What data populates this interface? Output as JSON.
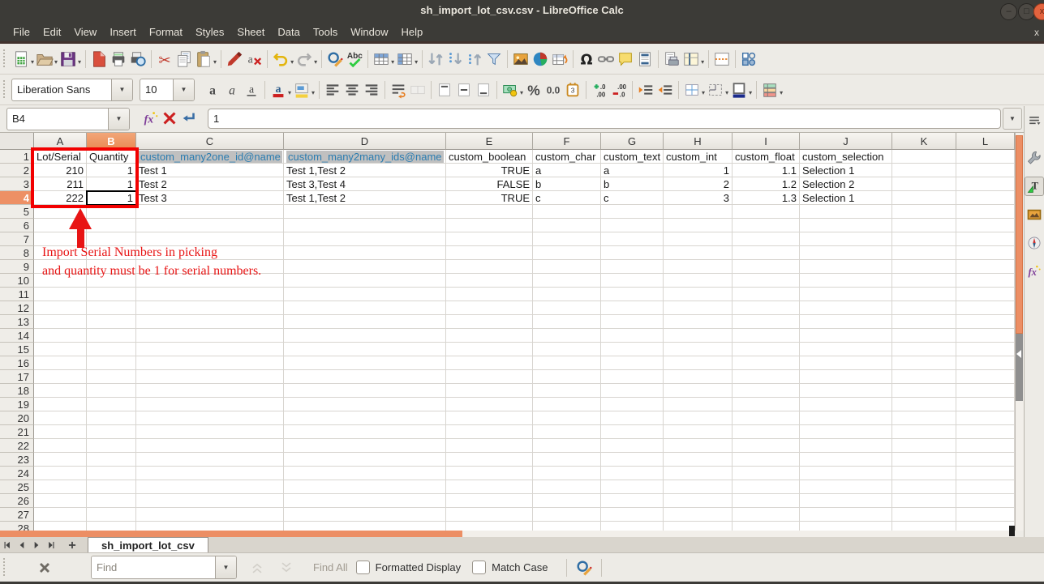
{
  "window": {
    "title": "sh_import_lot_csv.csv - LibreOffice Calc",
    "controls": [
      "minimize",
      "maximize",
      "close"
    ]
  },
  "menubar": {
    "items": [
      "File",
      "Edit",
      "View",
      "Insert",
      "Format",
      "Styles",
      "Sheet",
      "Data",
      "Tools",
      "Window",
      "Help"
    ]
  },
  "standard_toolbar": {
    "groups": [
      [
        {
          "name": "new-document",
          "dropdown": true
        },
        {
          "name": "open-folder",
          "dropdown": true
        },
        {
          "name": "save",
          "dropdown": true
        }
      ],
      [
        {
          "name": "export-pdf"
        },
        {
          "name": "print"
        },
        {
          "name": "print-preview"
        }
      ],
      [
        {
          "name": "cut"
        },
        {
          "name": "copy"
        },
        {
          "name": "paste",
          "dropdown": true
        }
      ],
      [
        {
          "name": "clone-formatting"
        },
        {
          "name": "clear-formatting"
        }
      ],
      [
        {
          "name": "undo",
          "dropdown": true
        },
        {
          "name": "redo",
          "dropdown": true
        }
      ],
      [
        {
          "name": "find-replace"
        },
        {
          "name": "spelling"
        }
      ],
      [
        {
          "name": "insert-row",
          "dropdown": true
        },
        {
          "name": "insert-column",
          "dropdown": true
        }
      ],
      [
        {
          "name": "sort"
        },
        {
          "name": "sort-descending"
        },
        {
          "name": "sort-ascending"
        },
        {
          "name": "autofilter"
        }
      ],
      [
        {
          "name": "insert-image"
        },
        {
          "name": "insert-chart"
        },
        {
          "name": "insert-pivot-table"
        }
      ],
      [
        {
          "name": "special-character"
        },
        {
          "name": "hyperlink"
        },
        {
          "name": "insert-comment"
        },
        {
          "name": "headers-footers"
        }
      ],
      [
        {
          "name": "print-area"
        },
        {
          "name": "freeze-panes",
          "dropdown": true
        }
      ],
      [
        {
          "name": "split-window"
        }
      ],
      [
        {
          "name": "show-draw-functions"
        }
      ]
    ]
  },
  "formatting_toolbar": {
    "font_name": "Liberation Sans",
    "font_size": "10",
    "groups": [
      [
        {
          "name": "bold"
        },
        {
          "name": "italic"
        },
        {
          "name": "underline"
        }
      ],
      [
        {
          "name": "font-color",
          "dropdown": true
        },
        {
          "name": "highlighting-color",
          "dropdown": true
        }
      ],
      [
        {
          "name": "align-left"
        },
        {
          "name": "align-center"
        },
        {
          "name": "align-right"
        }
      ],
      [
        {
          "name": "wrap-text"
        },
        {
          "name": "merge-cells",
          "disabled": true
        }
      ],
      [
        {
          "name": "align-top"
        },
        {
          "name": "center-vertically"
        },
        {
          "name": "align-bottom"
        }
      ],
      [
        {
          "name": "currency",
          "dropdown": true
        },
        {
          "name": "percent"
        },
        {
          "name": "number-format"
        },
        {
          "name": "date-format"
        }
      ],
      [
        {
          "name": "add-decimal"
        },
        {
          "name": "delete-decimal"
        }
      ],
      [
        {
          "name": "increase-indent"
        },
        {
          "name": "decrease-indent"
        }
      ],
      [
        {
          "name": "borders",
          "dropdown": true
        },
        {
          "name": "border-style",
          "dropdown": true
        },
        {
          "name": "border-color",
          "dropdown": true
        }
      ],
      [
        {
          "name": "conditional-formatting",
          "dropdown": true
        }
      ]
    ]
  },
  "formula_bar": {
    "cell_reference": "B4",
    "content": "1",
    "icons": [
      "function-wizard",
      "cancel",
      "accept"
    ]
  },
  "sheet": {
    "columns": [
      "A",
      "B",
      "C",
      "D",
      "E",
      "F",
      "G",
      "H",
      "I",
      "J",
      "K",
      "L"
    ],
    "selected_column": "B",
    "selected_row": 4,
    "visible_rows": 28,
    "highlighted_header_cells": [
      "C1",
      "D1"
    ],
    "data": [
      {
        "row": 1,
        "cells": {
          "A": "Lot/Serial",
          "B": "Quantity",
          "C": "custom_many2one_id@name",
          "D": "custom_many2many_ids@name",
          "E": "custom_boolean",
          "F": "custom_char",
          "G": "custom_text",
          "H": "custom_int",
          "I": "custom_float",
          "J": "custom_selection"
        }
      },
      {
        "row": 2,
        "cells": {
          "A": "210",
          "B": "1",
          "C": "Test 1",
          "D": "Test 1,Test 2",
          "E": "TRUE",
          "F": "a",
          "G": "a",
          "H": "1",
          "I": "1.1",
          "J": "Selection 1"
        }
      },
      {
        "row": 3,
        "cells": {
          "A": "211",
          "B": "1",
          "C": "Test 2",
          "D": "Test 3,Test 4",
          "E": "FALSE",
          "F": "b",
          "G": "b",
          "H": "2",
          "I": "1.2",
          "J": "Selection 2"
        }
      },
      {
        "row": 4,
        "cells": {
          "A": "222",
          "B": "1",
          "C": "Test 3",
          "D": "Test 1,Test 2",
          "E": "TRUE",
          "F": "c",
          "G": "c",
          "H": "3",
          "I": "1.3",
          "J": "Selection 1"
        }
      }
    ]
  },
  "annotation": {
    "line1": "Import Serial Numbers in picking",
    "line2": "and quantity must be 1 for serial numbers."
  },
  "sheet_tabs": {
    "nav_icons": [
      "first-sheet",
      "previous-sheet",
      "next-sheet",
      "last-sheet",
      "add-sheet"
    ],
    "active_tab": "sh_import_lot_csv"
  },
  "find_bar": {
    "placeholder": "Find",
    "find_all_label": "Find All",
    "formatted_display_label": "Formatted Display",
    "match_case_label": "Match Case",
    "icons": [
      "close",
      "find-previous",
      "find-next",
      "find-and-replace"
    ]
  },
  "sidebar": {
    "icons": [
      "sidebar-menu",
      "properties",
      "styles",
      "gallery",
      "navigator",
      "functions"
    ]
  },
  "colors": {
    "accent_orange": "#EC8E64",
    "annotation_red": "#E81414",
    "header_link_blue": "#2B7CB0",
    "header_link_bg": "#C0C0C0",
    "titlebar": "#3C3B37"
  }
}
